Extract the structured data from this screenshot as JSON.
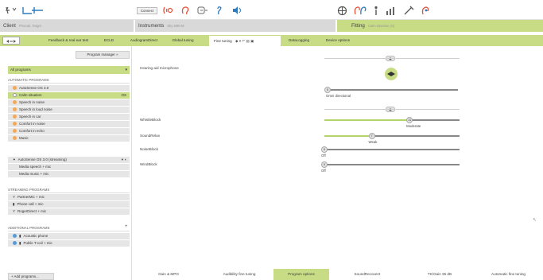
{
  "toolbar": {
    "connect_label": "Connect",
    "icons_left": [
      "hearing-aid-icon",
      "wave-icon",
      "ear-left-icon",
      "battery-icon",
      "ear-right-icon",
      "volume-icon"
    ],
    "icons_right": [
      "target-icon",
      "ear-pair-icon",
      "person-icon",
      "audiogram-bars-icon",
      "tools-icon",
      "ear-sound-icon"
    ]
  },
  "header": {
    "client_label": "Client",
    "client_name": "Phonak, Target",
    "instruments_label": "Instruments",
    "instruments_sub": "Sky M90-M",
    "fitting_label": "Fitting",
    "fitting_sub": "Calm situation (S)"
  },
  "tabs": [
    {
      "label": "Feedback & real ear test"
    },
    {
      "label": "ECLD"
    },
    {
      "label": "AudiogramDirect"
    },
    {
      "label": "Global tuning"
    },
    {
      "label": "Fine tuning"
    },
    {
      "label": "DataLogging"
    },
    {
      "label": "Device options"
    }
  ],
  "sidebar": {
    "program_manager": "Program manager",
    "selected_program": "All programs",
    "sections": {
      "automatic": "AUTOMATIC PROGRAMS",
      "streaming": "STREAMING PROGRAMS",
      "additional": "ADDITIONAL PROGRAMS"
    },
    "automatic_items": [
      {
        "label": "AutoSense OS 3.0",
        "badge": ""
      },
      {
        "label": "Calm situation",
        "badge": "OS"
      },
      {
        "label": "Speech in noise",
        "badge": ""
      },
      {
        "label": "Speech in loud noise",
        "badge": ""
      },
      {
        "label": "Speech in car",
        "badge": ""
      },
      {
        "label": "Comfort in noise",
        "badge": ""
      },
      {
        "label": "Comfort in echo",
        "badge": ""
      },
      {
        "label": "Music",
        "badge": ""
      }
    ],
    "streaming_header_item": "AutoSense OS 3.0 (streaming)",
    "streaming_sub_items": [
      "Media speech + mic",
      "Media music + mic"
    ],
    "streaming_items": [
      "PartnerMic + mic",
      "Phone call + mic",
      "RogerDirect + mic"
    ],
    "additional_items": [
      "Acoustic phone",
      "Public T-coil + mic"
    ],
    "add_programs": "+ Add programs..."
  },
  "main": {
    "microphone_label": "Hearing aid microphone",
    "omni_value": "0",
    "omni_label": "Omni directional",
    "rows": [
      {
        "label": "WhistleBlock",
        "value": "11",
        "caption": "Moderate",
        "level": 0.63
      },
      {
        "label": "SoundRelax",
        "value": "7",
        "caption": "Weak",
        "level": 0.35
      },
      {
        "label": "NoiseBlock",
        "value": "0",
        "caption": "Off",
        "level": 0.0
      },
      {
        "label": "WindBlock",
        "value": "0",
        "caption": "Off",
        "level": 0.0
      }
    ]
  },
  "bottom_tabs": [
    {
      "label": "Gain & MPO"
    },
    {
      "label": "Audibility fine tuning"
    },
    {
      "label": "Program options"
    },
    {
      "label": "SoundRecover2"
    },
    {
      "label": "TK/Gain 35 dB"
    },
    {
      "label": "Automatic fine tuning"
    }
  ],
  "colors": {
    "accent": "#c7dc85",
    "orange": "#f2a95c",
    "red": "#e0523a",
    "teal": "#3aa6a0"
  }
}
